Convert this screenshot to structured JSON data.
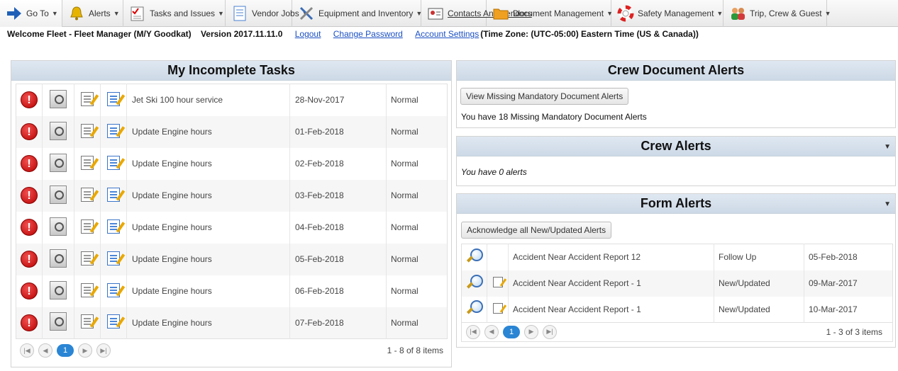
{
  "nav": [
    {
      "label": "Go To",
      "icon": "arrow-right-icon",
      "caret": "▼"
    },
    {
      "label": "Alerts",
      "icon": "bell-icon",
      "caret": "▼"
    },
    {
      "label": "Tasks and Issues",
      "icon": "checklist-icon",
      "caret": "▼"
    },
    {
      "label": "Vendor Jobs",
      "icon": "document-icon",
      "caret": "▼"
    },
    {
      "label": "Equipment and Inventory",
      "icon": "tools-icon",
      "caret": "▼"
    },
    {
      "label": "Contacts And Vendors",
      "icon": "contact-card-icon"
    },
    {
      "label": "Document Management",
      "icon": "folder-icon",
      "caret": "▼"
    },
    {
      "label": "Safety Management",
      "icon": "lifebuoy-icon",
      "caret": "▼"
    },
    {
      "label": "Trip, Crew & Guest",
      "icon": "people-icon",
      "caret": "▼"
    }
  ],
  "welcome": {
    "text": "Welcome Fleet - Fleet Manager (M/Y Goodkat)    Version 2017.11.11.0",
    "logout": "Logout",
    "change_password": "Change Password",
    "account_settings": "Account Settings",
    "timezone": "(Time Zone: (UTC-05:00) Eastern Time (US & Canada))"
  },
  "tasks_panel": {
    "title": "My Incomplete Tasks",
    "rows": [
      {
        "name": "Jet Ski 100 hour service",
        "date": "28-Nov-2017",
        "priority": "Normal"
      },
      {
        "name": "Update Engine hours",
        "date": "01-Feb-2018",
        "priority": "Normal"
      },
      {
        "name": "Update Engine hours",
        "date": "02-Feb-2018",
        "priority": "Normal"
      },
      {
        "name": "Update Engine hours",
        "date": "03-Feb-2018",
        "priority": "Normal"
      },
      {
        "name": "Update Engine hours",
        "date": "04-Feb-2018",
        "priority": "Normal"
      },
      {
        "name": "Update Engine hours",
        "date": "05-Feb-2018",
        "priority": "Normal"
      },
      {
        "name": "Update Engine hours",
        "date": "06-Feb-2018",
        "priority": "Normal"
      },
      {
        "name": "Update Engine hours",
        "date": "07-Feb-2018",
        "priority": "Normal"
      }
    ],
    "pager": {
      "first": "|◀",
      "prev": "◀",
      "current": "1",
      "next": "▶",
      "last": "▶|",
      "info": "1 - 8 of 8 items"
    }
  },
  "crew_doc_panel": {
    "title": "Crew Document Alerts",
    "button": "View Missing Mandatory Document Alerts",
    "message": "You have 18 Missing Mandatory Document Alerts"
  },
  "crew_alerts_panel": {
    "title": "Crew Alerts",
    "message": "You have 0 alerts",
    "caret": "▼"
  },
  "form_alerts_panel": {
    "title": "Form Alerts",
    "caret": "▼",
    "button": "Acknowledge all New/Updated Alerts",
    "rows": [
      {
        "name": "Accident Near Accident Report 12",
        "status": "Follow Up",
        "date": "05-Feb-2018",
        "has_edit": false
      },
      {
        "name": "Accident Near Accident Report - 1",
        "status": "New/Updated",
        "date": "09-Mar-2017",
        "has_edit": true
      },
      {
        "name": "Accident Near Accident Report - 1",
        "status": "New/Updated",
        "date": "10-Mar-2017",
        "has_edit": true
      }
    ],
    "pager": {
      "first": "|◀",
      "prev": "◀",
      "current": "1",
      "next": "▶",
      "last": "▶|",
      "info": "1 - 3 of 3 items"
    }
  },
  "icon_glyphs": {
    "alert": "!"
  }
}
